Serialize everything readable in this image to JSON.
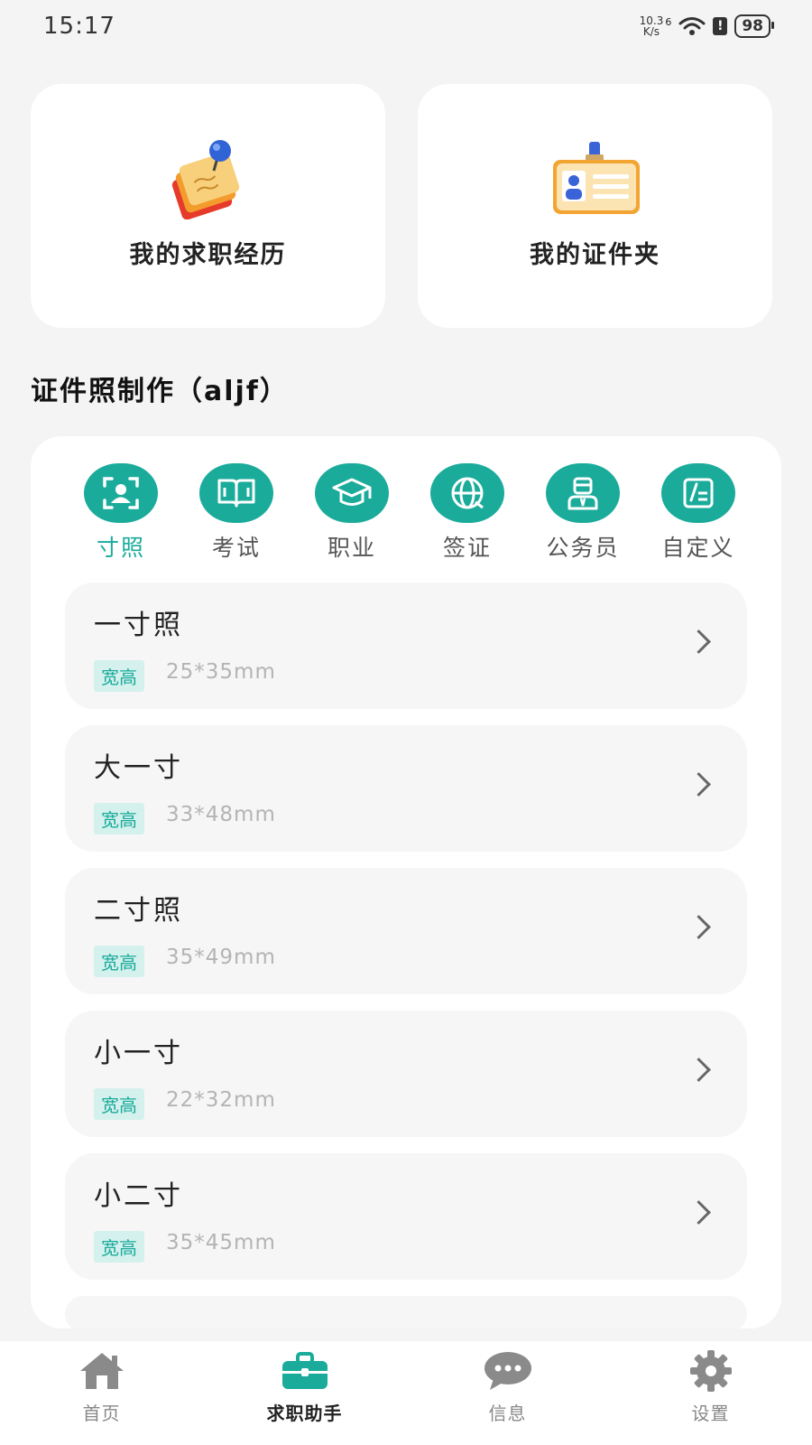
{
  "status_bar": {
    "time": "15:17",
    "net_speed_value": "10.3",
    "net_speed_unit": "K/s",
    "signal_label": "6",
    "battery": "98",
    "alert_icon": "!"
  },
  "top_cards": [
    {
      "label": "我的求职经历",
      "icon": "notes-pin-icon"
    },
    {
      "label": "我的证件夹",
      "icon": "id-badge-icon"
    }
  ],
  "section": {
    "title": "证件照制作（aljf）"
  },
  "categories": [
    {
      "label": "寸照",
      "icon": "portrait-frame-icon",
      "active": true
    },
    {
      "label": "考试",
      "icon": "book-icon",
      "active": false
    },
    {
      "label": "职业",
      "icon": "graduation-cap-icon",
      "active": false
    },
    {
      "label": "签证",
      "icon": "globe-icon",
      "active": false
    },
    {
      "label": "公务员",
      "icon": "official-person-icon",
      "active": false
    },
    {
      "label": "自定义",
      "icon": "edit-icon",
      "active": false
    }
  ],
  "size_items": [
    {
      "name": "一寸照",
      "tag": "宽高",
      "size": "25*35mm"
    },
    {
      "name": "大一寸",
      "tag": "宽高",
      "size": "33*48mm"
    },
    {
      "name": "二寸照",
      "tag": "宽高",
      "size": "35*49mm"
    },
    {
      "name": "小一寸",
      "tag": "宽高",
      "size": "22*32mm"
    },
    {
      "name": "小二寸",
      "tag": "宽高",
      "size": "35*45mm"
    }
  ],
  "bottom_nav": [
    {
      "label": "首页",
      "icon": "home-icon",
      "active": false
    },
    {
      "label": "求职助手",
      "icon": "briefcase-icon",
      "active": true
    },
    {
      "label": "信息",
      "icon": "chat-bubble-icon",
      "active": false
    },
    {
      "label": "设置",
      "icon": "gear-icon",
      "active": false
    }
  ],
  "colors": {
    "accent": "#1aab9b",
    "tag_bg": "#d4f1ed",
    "background": "#f4f4f4",
    "nav_inactive": "#888888"
  }
}
